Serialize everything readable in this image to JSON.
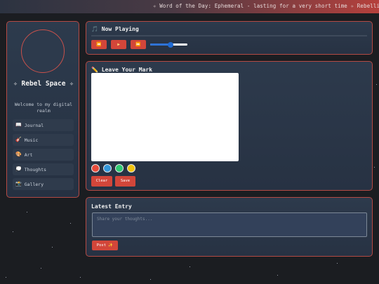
{
  "ticker": {
    "text": "✧ Word of the Day: Ephemeral - lasting for a very short time ✧ Rebellion - resi"
  },
  "sidebar": {
    "title": "✧ Rebel Space ✧",
    "tagline": "Welcome to my digital realm",
    "nav": [
      {
        "icon": "📖",
        "icon_name": "book-icon",
        "label": "Journal"
      },
      {
        "icon": "🎸",
        "icon_name": "guitar-icon",
        "label": "Music"
      },
      {
        "icon": "🎨",
        "icon_name": "palette-icon",
        "label": "Art"
      },
      {
        "icon": "💭",
        "icon_name": "thought-bubble-icon",
        "label": "Thoughts"
      },
      {
        "icon": "📸",
        "icon_name": "camera-icon",
        "label": "Gallery"
      }
    ]
  },
  "player": {
    "title": "🎵 Now Playing",
    "controls": [
      {
        "name": "rewind-button",
        "icon": "⏪",
        "icon_name": "rewind-icon"
      },
      {
        "name": "play-button",
        "icon": "▶",
        "icon_name": "play-icon"
      },
      {
        "name": "fast-forward-button",
        "icon": "⏩",
        "icon_name": "fast-forward-icon"
      }
    ],
    "volume": 0.55
  },
  "canvas": {
    "title": "✏️ Leave Your Mark",
    "colors": [
      "#e74c3c",
      "#3498db",
      "#2ecc71",
      "#f1c40f"
    ],
    "clear_label": "Clear",
    "save_label": "Save"
  },
  "entry": {
    "title": "Latest Entry",
    "placeholder": "Share your thoughts...",
    "value": "",
    "post_label": "Post ✨"
  },
  "colors": {
    "accent": "#d2463a",
    "panel_border": "#b44a44",
    "background": "#1b1d21"
  }
}
